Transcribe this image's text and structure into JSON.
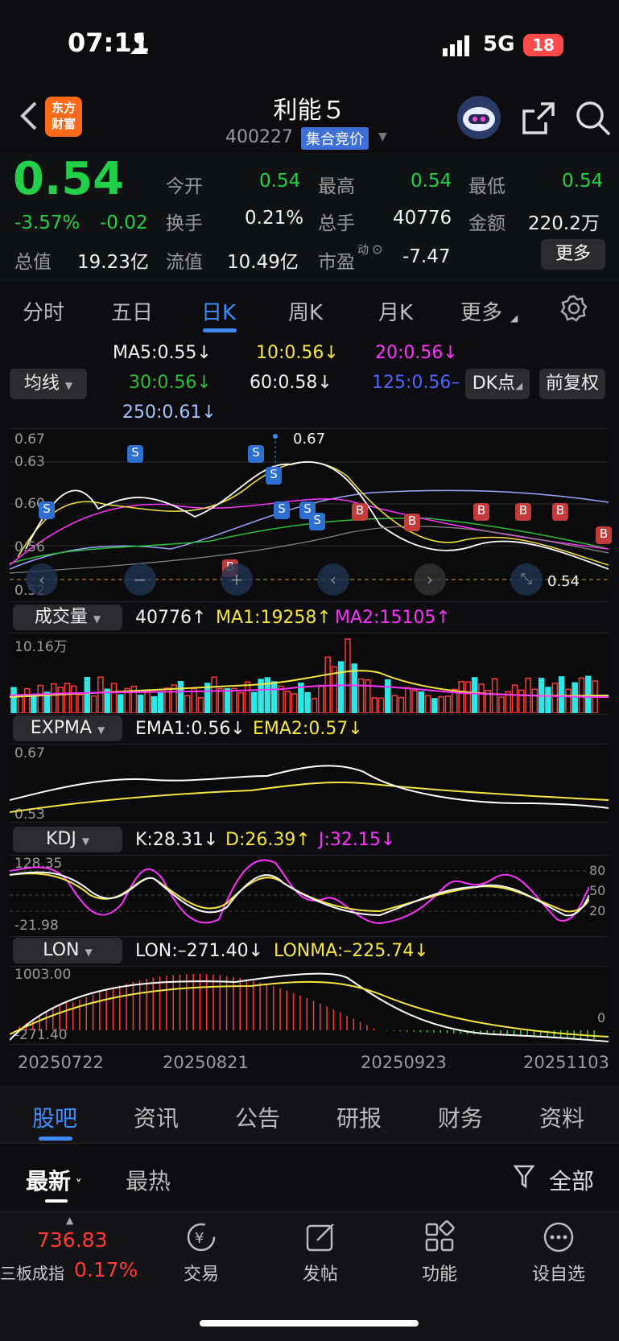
{
  "status_bar": {
    "time": "07:11",
    "network": "5G",
    "battery": "18"
  },
  "header": {
    "title": "利能５",
    "code": "400227",
    "auction_badge": "集合竞价",
    "logo_text_1": "东方",
    "logo_text_2": "财富"
  },
  "quote": {
    "price": "0.54",
    "change_pct": "-3.57%",
    "change": "-0.02",
    "labels": {
      "open": "今开",
      "high": "最高",
      "low": "最低",
      "turnover": "换手",
      "volume": "总手",
      "amount": "金额",
      "total_mv": "总值",
      "float_mv": "流值",
      "pe": "市盈",
      "pe_sup": "动"
    },
    "open": "0.54",
    "high": "0.54",
    "low": "0.54",
    "turnover": "0.21%",
    "volume": "40776",
    "amount": "220.2万",
    "total_mv": "19.23亿",
    "float_mv": "10.49亿",
    "pe": "-7.47",
    "more": "更多"
  },
  "tabs": [
    "分时",
    "五日",
    "日K",
    "周K",
    "月K",
    "更多"
  ],
  "active_tab": "日K",
  "ma_panel": {
    "selector": "均线",
    "ma5": "MA5:0.55↓",
    "ma10": "10:0.56↓",
    "ma20": "20:0.56↓",
    "ma30": "30:0.56↓",
    "ma60": "60:0.58↓",
    "ma125": "125:0.56–",
    "ma250": "250:0.61↓",
    "dk_button": "DK点",
    "fq_button": "前复权"
  },
  "kline": {
    "y_labels": [
      "0.67",
      "0.63",
      "0.60",
      "0.56",
      "0.52"
    ],
    "high_marker": "0.67",
    "last_price": "0.54"
  },
  "volume_panel": {
    "selector": "成交量",
    "value": "40776↑",
    "ma1": "MA1:19258↑",
    "ma2": "MA2:15105↑",
    "max_label": "10.16万"
  },
  "expma_panel": {
    "selector": "EXPMA",
    "ema1": "EMA1:0.56↓",
    "ema2": "EMA2:0.57↓",
    "top": "0.67",
    "bottom": "0.53"
  },
  "kdj_panel": {
    "selector": "KDJ",
    "k": "K:28.31↓",
    "d": "D:26.39↑",
    "j": "J:32.15↓",
    "top": "128.35",
    "bottom": "-21.98",
    "levels": [
      "80",
      "50",
      "20"
    ]
  },
  "lon_panel": {
    "selector": "LON",
    "lon": "LON:–271.40↓",
    "lonma": "LONMA:–225.74↓",
    "top": "1003.00",
    "bottom": "-271.40",
    "zero": "0"
  },
  "dates": [
    "20250722",
    "20250821",
    "20250923",
    "20251103"
  ],
  "bottom_tabs": [
    "股吧",
    "资讯",
    "公告",
    "研报",
    "财务",
    "资料"
  ],
  "sub_tabs": {
    "newest": "最新",
    "hottest": "最热",
    "filter": "全部"
  },
  "footer": {
    "index_value": "736.83",
    "index_name": "三板成指",
    "index_change": "0.17%",
    "items": [
      "交易",
      "发帖",
      "功能",
      "设自选"
    ]
  },
  "chart_data": {
    "type": "candlestick",
    "ylim": [
      0.52,
      0.67
    ],
    "volume_max": "10.16万",
    "kdj_range": [
      -21.98,
      128.35
    ],
    "lon_range": [
      -271.4,
      1003.0
    ]
  }
}
